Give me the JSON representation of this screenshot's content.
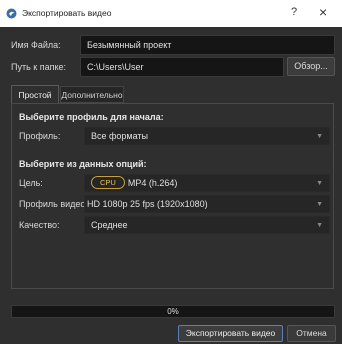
{
  "window": {
    "title": "Экспортировать видео",
    "help_glyph": "?",
    "close_glyph": "×"
  },
  "file": {
    "name_label": "Имя Файла:",
    "name_value": "Безымянный проект",
    "path_label": "Путь к папке:",
    "path_value": "C:\\Users\\User",
    "browse_label": "Обзор..."
  },
  "tabs": [
    {
      "label": "Простой",
      "active": true
    },
    {
      "label": "Дополнительно",
      "active": false
    }
  ],
  "profile_section": {
    "heading": "Выберите профиль для начала:",
    "profile_label": "Профиль:",
    "profile_value": "Все форматы"
  },
  "options_section": {
    "heading": "Выберите из данных опций:",
    "target_label": "Цель:",
    "target_badge": "CPU",
    "target_value": "MP4 (h.264)",
    "video_profile_label": "Профиль видео:",
    "video_profile_value": "HD 1080p 25 fps (1920x1080)",
    "quality_label": "Качество:",
    "quality_value": "Среднее"
  },
  "progress": {
    "value": 0,
    "label": "0%"
  },
  "footer": {
    "export_label": "Экспортировать видео",
    "cancel_label": "Отмена"
  },
  "icons": {
    "app": "openshot-logo-icon",
    "dropdown": "chevron-down-icon"
  },
  "colors": {
    "background": "#2f2f2f",
    "field": "#151515",
    "accent_border": "#5b7fb5",
    "cpu_badge": "#c8a040"
  }
}
